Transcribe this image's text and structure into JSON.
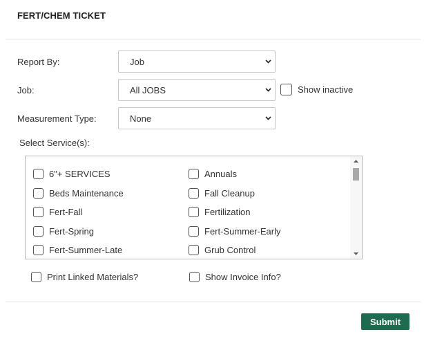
{
  "dialog": {
    "title": "FERT/CHEM TICKET"
  },
  "form": {
    "report_by": {
      "label": "Report By:",
      "value": "Job"
    },
    "job": {
      "label": "Job:",
      "value": "All JOBS",
      "show_inactive_label": "Show inactive"
    },
    "measurement_type": {
      "label": "Measurement Type:",
      "value": "None"
    }
  },
  "services": {
    "label": "Select Service(s):",
    "items": [
      "6\"+ SERVICES",
      "Annuals",
      "Beds Maintenance",
      "Fall Cleanup",
      "Fert-Fall",
      "Fertilization",
      "Fert-Spring",
      "Fert-Summer-Early",
      "Fert-Summer-Late",
      "Grub Control"
    ]
  },
  "options": {
    "print_linked_materials": "Print Linked Materials?",
    "show_invoice_info": "Show Invoice Info?"
  },
  "actions": {
    "submit_label": "Submit"
  },
  "colors": {
    "submit_bg": "#1e6b4f",
    "divider": "#e1e1e1"
  },
  "icons": {
    "select_arrow": "chevron-down-icon"
  }
}
